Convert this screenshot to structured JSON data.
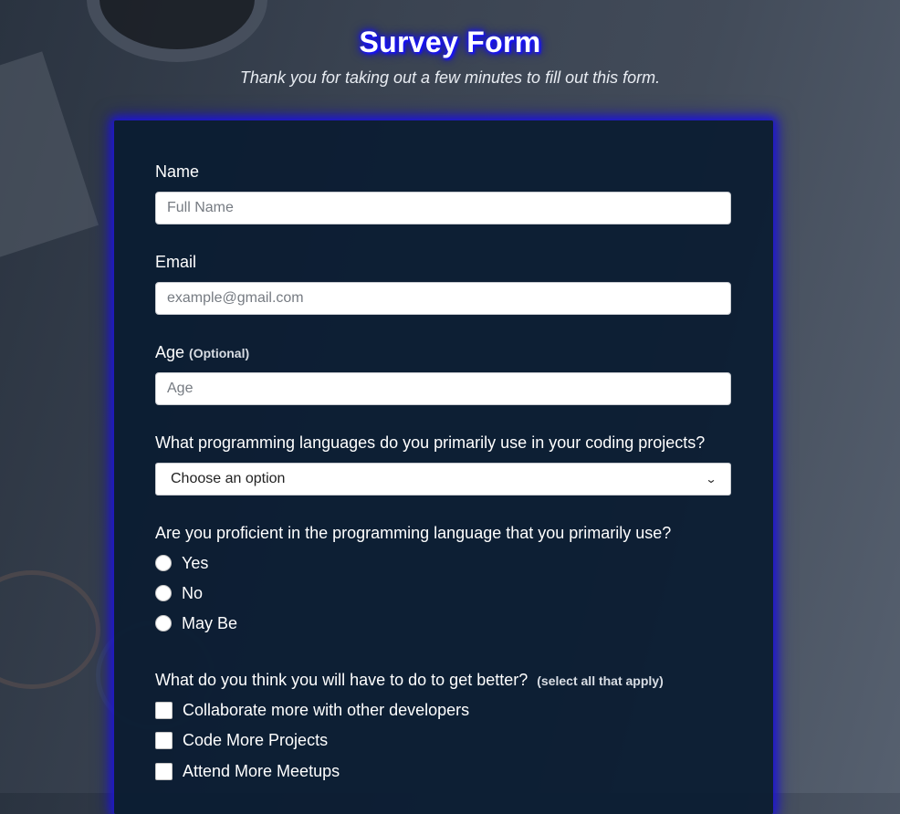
{
  "header": {
    "title": "Survey Form",
    "description": "Thank you for taking out a few minutes to fill out this form."
  },
  "form": {
    "name": {
      "label": "Name",
      "placeholder": "Full Name"
    },
    "email": {
      "label": "Email",
      "placeholder": "example@gmail.com"
    },
    "age": {
      "label": "Age",
      "optional_note": "(Optional)",
      "placeholder": "Age"
    },
    "languages": {
      "label": "What programming languages do you primarily use in your coding projects?",
      "selected": "Choose an option"
    },
    "proficiency": {
      "label": "Are you proficient in the programming language that you primarily use?",
      "options": [
        "Yes",
        "No",
        "May Be"
      ]
    },
    "improvements": {
      "label": "What do you think you will have to do to get better?",
      "note": "(select all that apply)",
      "options": [
        "Collaborate more with other developers",
        "Code More Projects",
        "Attend More Meetups"
      ]
    }
  },
  "colors": {
    "title_glow": "#1a14ff",
    "card_background": "#0a1c32",
    "card_glow": "#1f16d6"
  },
  "icons": {
    "select_arrow": "chevron-down-icon"
  }
}
